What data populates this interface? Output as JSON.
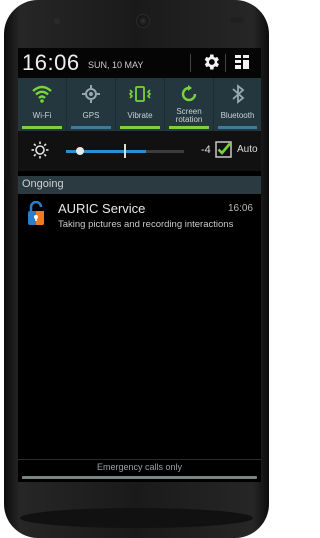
{
  "status": {
    "time": "16:06",
    "date": "SUN, 10 MAY"
  },
  "quick_settings": [
    {
      "label": "Wi-Fi",
      "icon": "wifi-icon",
      "active": true
    },
    {
      "label": "GPS",
      "icon": "gps-icon",
      "active": false
    },
    {
      "label": "Vibrate",
      "icon": "vibrate-icon",
      "active": true
    },
    {
      "label": "Screen rotation",
      "icon": "rotation-icon",
      "active": true
    },
    {
      "label": "Bluetooth",
      "icon": "bluetooth-icon",
      "active": false
    }
  ],
  "brightness": {
    "value": "-4",
    "auto_label": "Auto",
    "auto_checked": true
  },
  "section": {
    "ongoing_label": "Ongoing"
  },
  "notification": {
    "title": "AURIC Service",
    "time": "16:06",
    "text": "Taking pictures and recording interactions",
    "icon": "lock-icon"
  },
  "footer": {
    "emergency": "Emergency calls only"
  },
  "colors": {
    "accent_green": "#79d33a",
    "accent_blue": "#2a8fd0",
    "tile_bg": "#24363e"
  }
}
